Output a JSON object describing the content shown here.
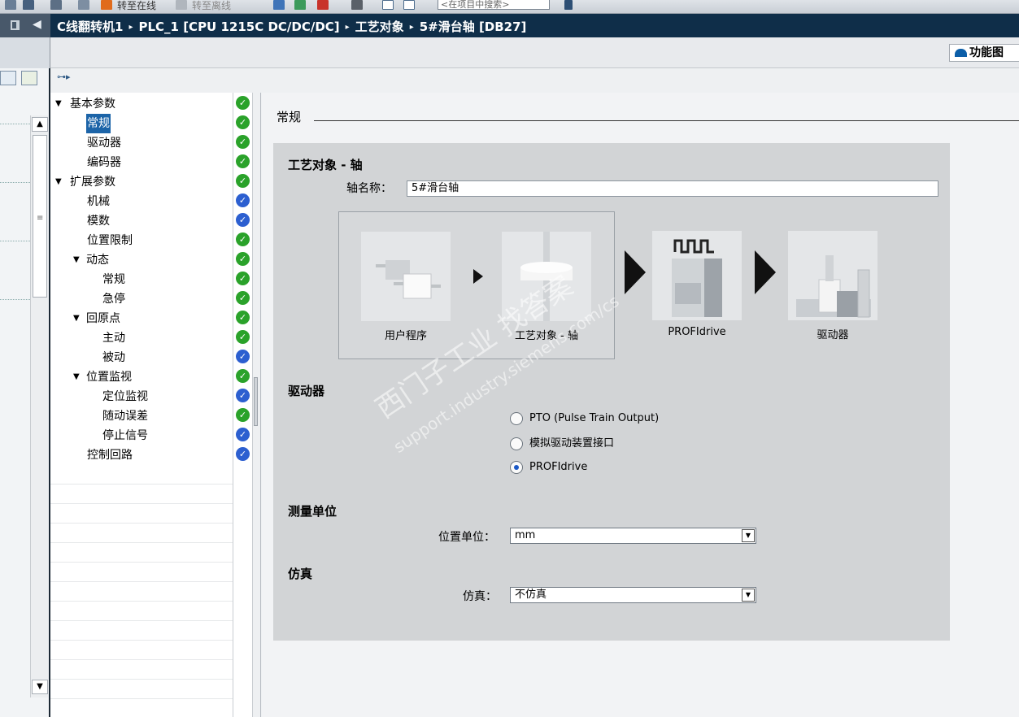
{
  "toolbar": {
    "go_online": "转至在线",
    "go_offline": "转至离线",
    "search_placeholder": "<在项目中搜索>"
  },
  "breadcrumb": {
    "items": [
      "C线翻转机1",
      "PLC_1 [CPU 1215C DC/DC/DC]",
      "工艺对象",
      "5#滑台轴 [DB27]"
    ],
    "separator": "▸"
  },
  "function_tab": {
    "label": "功能图"
  },
  "nav": {
    "items": [
      {
        "label": "基本参数",
        "status": "ok"
      },
      {
        "label": "常规",
        "status": "ok",
        "selected": true
      },
      {
        "label": "驱动器",
        "status": "ok"
      },
      {
        "label": "编码器",
        "status": "ok"
      },
      {
        "label": "扩展参数",
        "status": "ok"
      },
      {
        "label": "机械",
        "status": "info"
      },
      {
        "label": "模数",
        "status": "info"
      },
      {
        "label": "位置限制",
        "status": "ok"
      },
      {
        "label": "动态",
        "status": "ok"
      },
      {
        "label": "常规",
        "status": "ok"
      },
      {
        "label": "急停",
        "status": "ok"
      },
      {
        "label": "回原点",
        "status": "ok"
      },
      {
        "label": "主动",
        "status": "ok"
      },
      {
        "label": "被动",
        "status": "info"
      },
      {
        "label": "位置监视",
        "status": "ok"
      },
      {
        "label": "定位监视",
        "status": "info"
      },
      {
        "label": "随动误差",
        "status": "ok"
      },
      {
        "label": "停止信号",
        "status": "info"
      },
      {
        "label": "控制回路",
        "status": "info"
      }
    ]
  },
  "status_colors": {
    "ok": "#2aa22a",
    "info": "#2c5fd0"
  },
  "content": {
    "section_title": "常规",
    "tech_object": {
      "title": "工艺对象 - 轴",
      "axis_name_label": "轴名称：",
      "axis_name_value": "5#滑台轴"
    },
    "diagram": {
      "tiles": [
        "用户程序",
        "工艺对象 - 轴",
        "PROFIdrive",
        "驱动器"
      ]
    },
    "drive": {
      "title": "驱动器",
      "options": [
        {
          "label": "PTO (Pulse Train Output)",
          "checked": false
        },
        {
          "label": "模拟驱动装置接口",
          "checked": false
        },
        {
          "label": "PROFIdrive",
          "checked": true
        }
      ]
    },
    "units": {
      "title": "测量单位",
      "position_unit_label": "位置单位：",
      "position_unit_value": "mm"
    },
    "simulation": {
      "title": "仿真",
      "label": "仿真：",
      "value": "不仿真"
    }
  },
  "watermark": {
    "line1": "西门子工业 找答案",
    "line2": "support.industry.siemens.com/cs"
  }
}
